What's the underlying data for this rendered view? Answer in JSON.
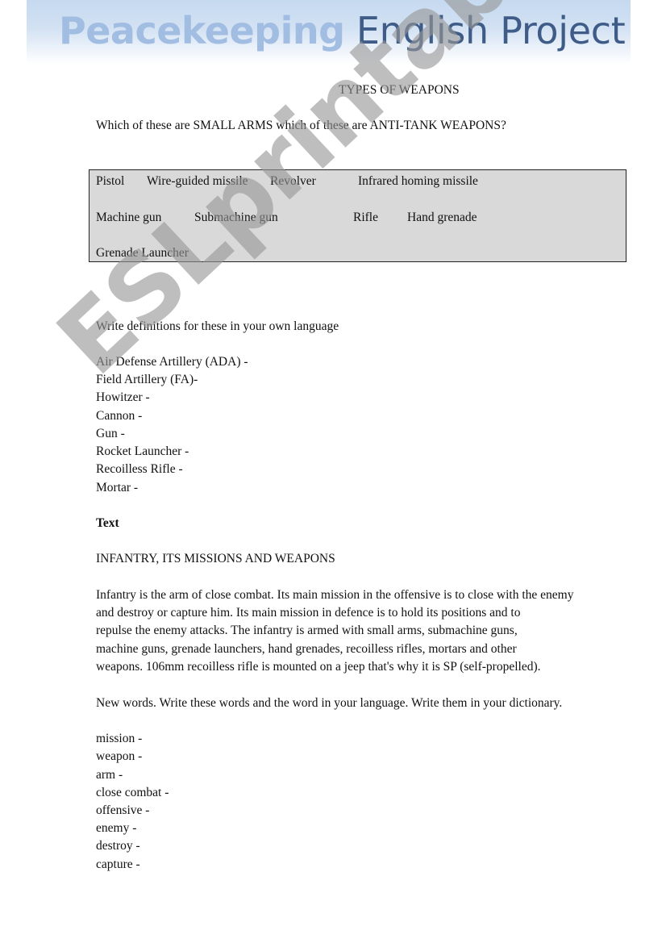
{
  "header": {
    "title_bold": "Peacekeeping",
    "title_light": " English Project",
    "colors": {
      "bold": "#a2bde2",
      "light": "#3e5c87",
      "band_top": "#c5d9f0"
    }
  },
  "title": "TYPES OF WEAPONS",
  "question": "Which of these are SMALL ARMS which of these are ANTI-TANK WEAPONS?",
  "word_box": {
    "background": "#d9d9d9",
    "rows": [
      [
        "Pistol",
        "Wire-guided missile",
        "Revolver",
        "Infrared homing missile"
      ],
      [
        "Machine gun",
        "Submachine gun",
        "Rifle",
        "Hand grenade"
      ],
      [
        "Grenade Launcher"
      ]
    ]
  },
  "definitions": {
    "instruction": "Write definitions for these in your own language",
    "items": [
      "Air Defense Artillery (ADA) -",
      "Field Artillery (FA)-",
      "Howitzer -",
      "Cannon -",
      "Gun -",
      "Rocket Launcher -",
      "Recoilless Rifle -",
      "Mortar -"
    ]
  },
  "text_section": {
    "label": "Text",
    "heading": "INFANTRY, ITS MISSIONS AND WEAPONS",
    "paragraph_lines": [
      "Infantry is the arm of close combat. Its main mission in the offensive is to close with the enemy",
      "and destroy or capture him. Its main mission in defence is to hold its positions and to",
      "repulse the enemy attacks. The infantry is armed with small arms, submachine guns,",
      "machine guns, grenade launchers, hand grenades, recoilless rifles, mortars and other",
      "weapons. 106mm recoilless rifle is mounted on a jeep that's why it is SP (self-propelled)."
    ]
  },
  "new_words": {
    "instruction": "New words. Write these words and the word in your language. Write them in your dictionary.",
    "items": [
      "mission -",
      "weapon -",
      "arm -",
      "close combat -",
      "offensive -",
      "enemy -",
      "destroy -",
      "capture -"
    ]
  },
  "watermark": "ESLprintables.com"
}
